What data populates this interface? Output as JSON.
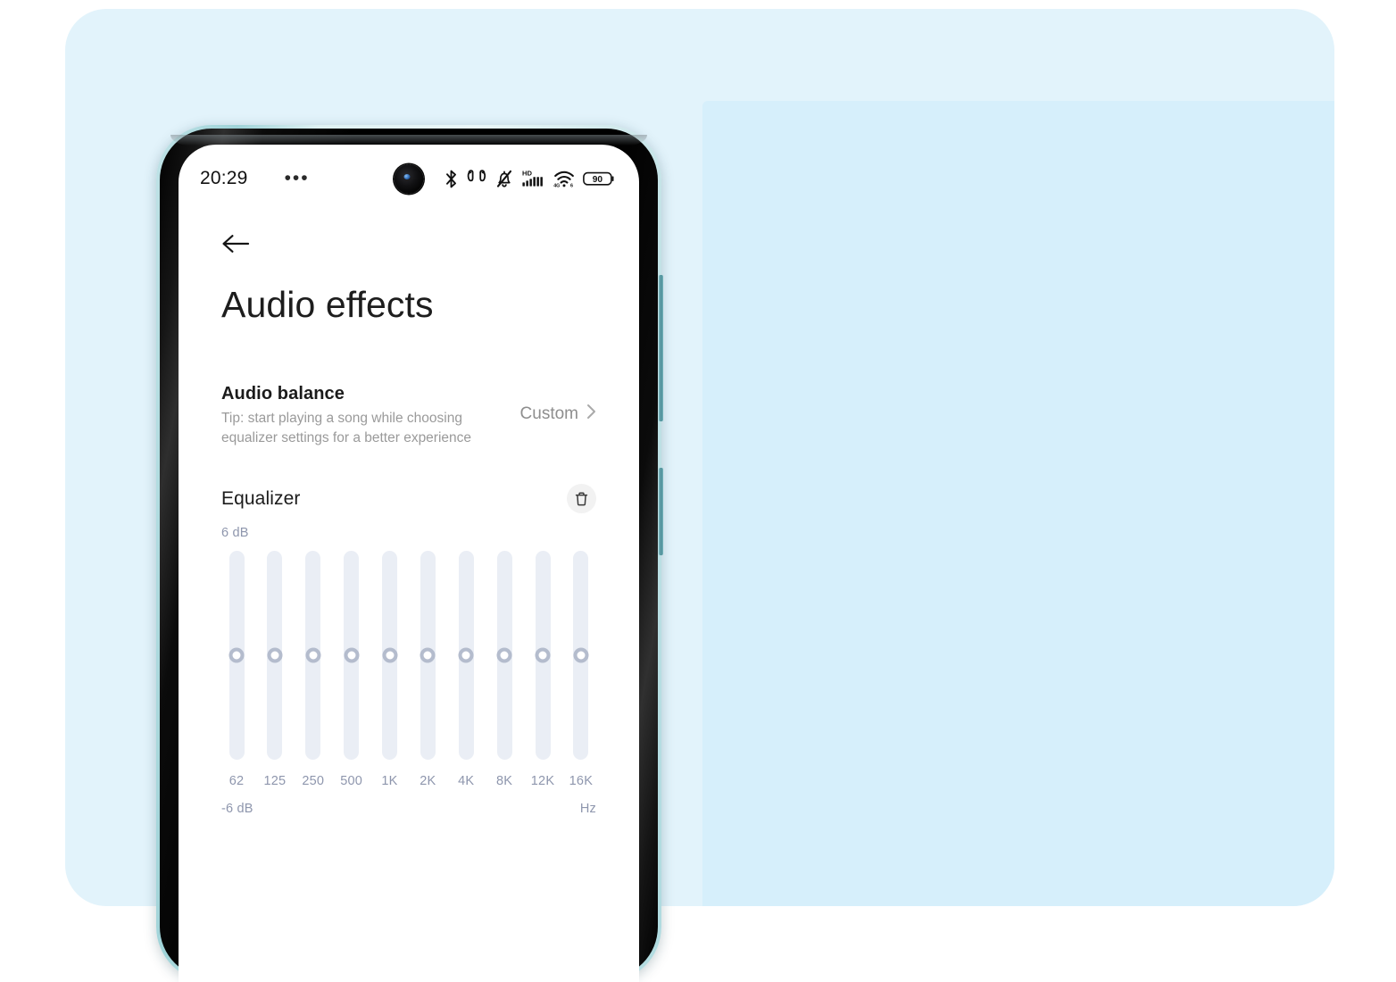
{
  "backdrop": {
    "panel_color": "#e2f3fb",
    "inner_panel_color": "#d6effb"
  },
  "status_bar": {
    "clock": "20:29",
    "overflow_dots": "•••",
    "icons": [
      {
        "name": "bluetooth-icon",
        "label": "Bluetooth"
      },
      {
        "name": "earbuds-icon",
        "label": "TWS earbuds connected"
      },
      {
        "name": "mute-bell-icon",
        "label": "Silent mode"
      },
      {
        "name": "hd-signal-icon",
        "label": "HD cellular signal"
      },
      {
        "name": "wifi-icon",
        "label": "Wi-Fi"
      },
      {
        "name": "battery-icon",
        "label": "Battery"
      }
    ],
    "battery_level": "90"
  },
  "app": {
    "back_label": "Back",
    "title": "Audio effects"
  },
  "audio_balance": {
    "title": "Audio balance",
    "tip": "Tip: start playing a song while choosing equalizer settings for a better experience",
    "value": "Custom",
    "chevron": "chevron-right-icon"
  },
  "equalizer": {
    "title": "Equalizer",
    "reset_icon": "trash-icon",
    "max_label": "6 dB",
    "min_label": "-6 dB",
    "unit_label": "Hz",
    "accent_color": "#8e96ad",
    "track_color": "#eaeef5",
    "thumb_color": "#b4bccd",
    "range_db": [
      -6,
      6
    ],
    "bands": [
      {
        "freq": "62",
        "gain_db": 0
      },
      {
        "freq": "125",
        "gain_db": 0
      },
      {
        "freq": "250",
        "gain_db": 0
      },
      {
        "freq": "500",
        "gain_db": 0
      },
      {
        "freq": "1K",
        "gain_db": 0
      },
      {
        "freq": "2K",
        "gain_db": 0
      },
      {
        "freq": "4K",
        "gain_db": 0
      },
      {
        "freq": "8K",
        "gain_db": 0
      },
      {
        "freq": "12K",
        "gain_db": 0
      },
      {
        "freq": "16K",
        "gain_db": 0
      }
    ]
  }
}
